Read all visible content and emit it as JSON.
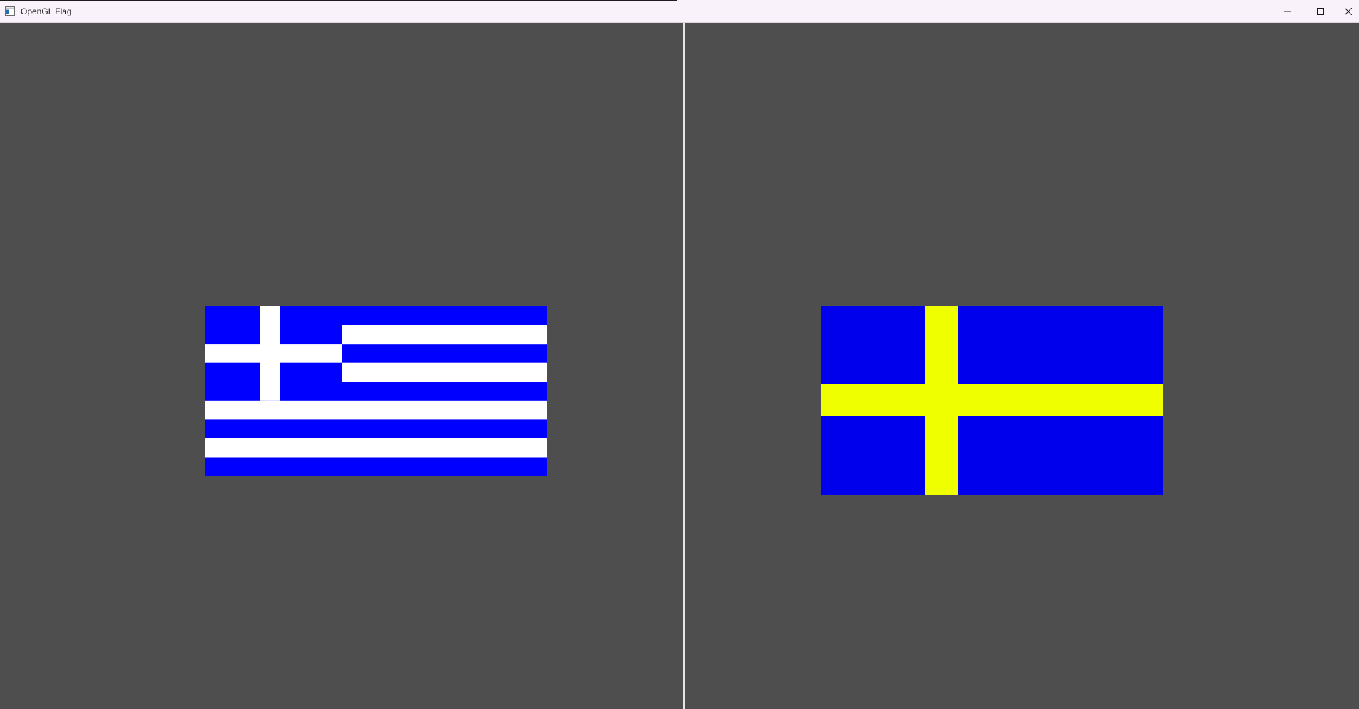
{
  "window": {
    "title": "OpenGL Flag",
    "icon": "opengl-app-window-icon",
    "controls": [
      "minimize-icon",
      "maximize-icon",
      "close-icon"
    ]
  },
  "viewports": [
    {
      "flag": "greece",
      "colors": {
        "blue": "#0000ff",
        "white": "#ffffff"
      },
      "stripes": 9,
      "canton_stripes": 5
    },
    {
      "flag": "sweden",
      "colors": {
        "blue": "#0000ec",
        "yellow": "#f0ff00"
      }
    }
  ],
  "colors": {
    "background": "#4e4e4e",
    "divider": "#e6e6e6",
    "titlebar": "#f9f2fa"
  }
}
